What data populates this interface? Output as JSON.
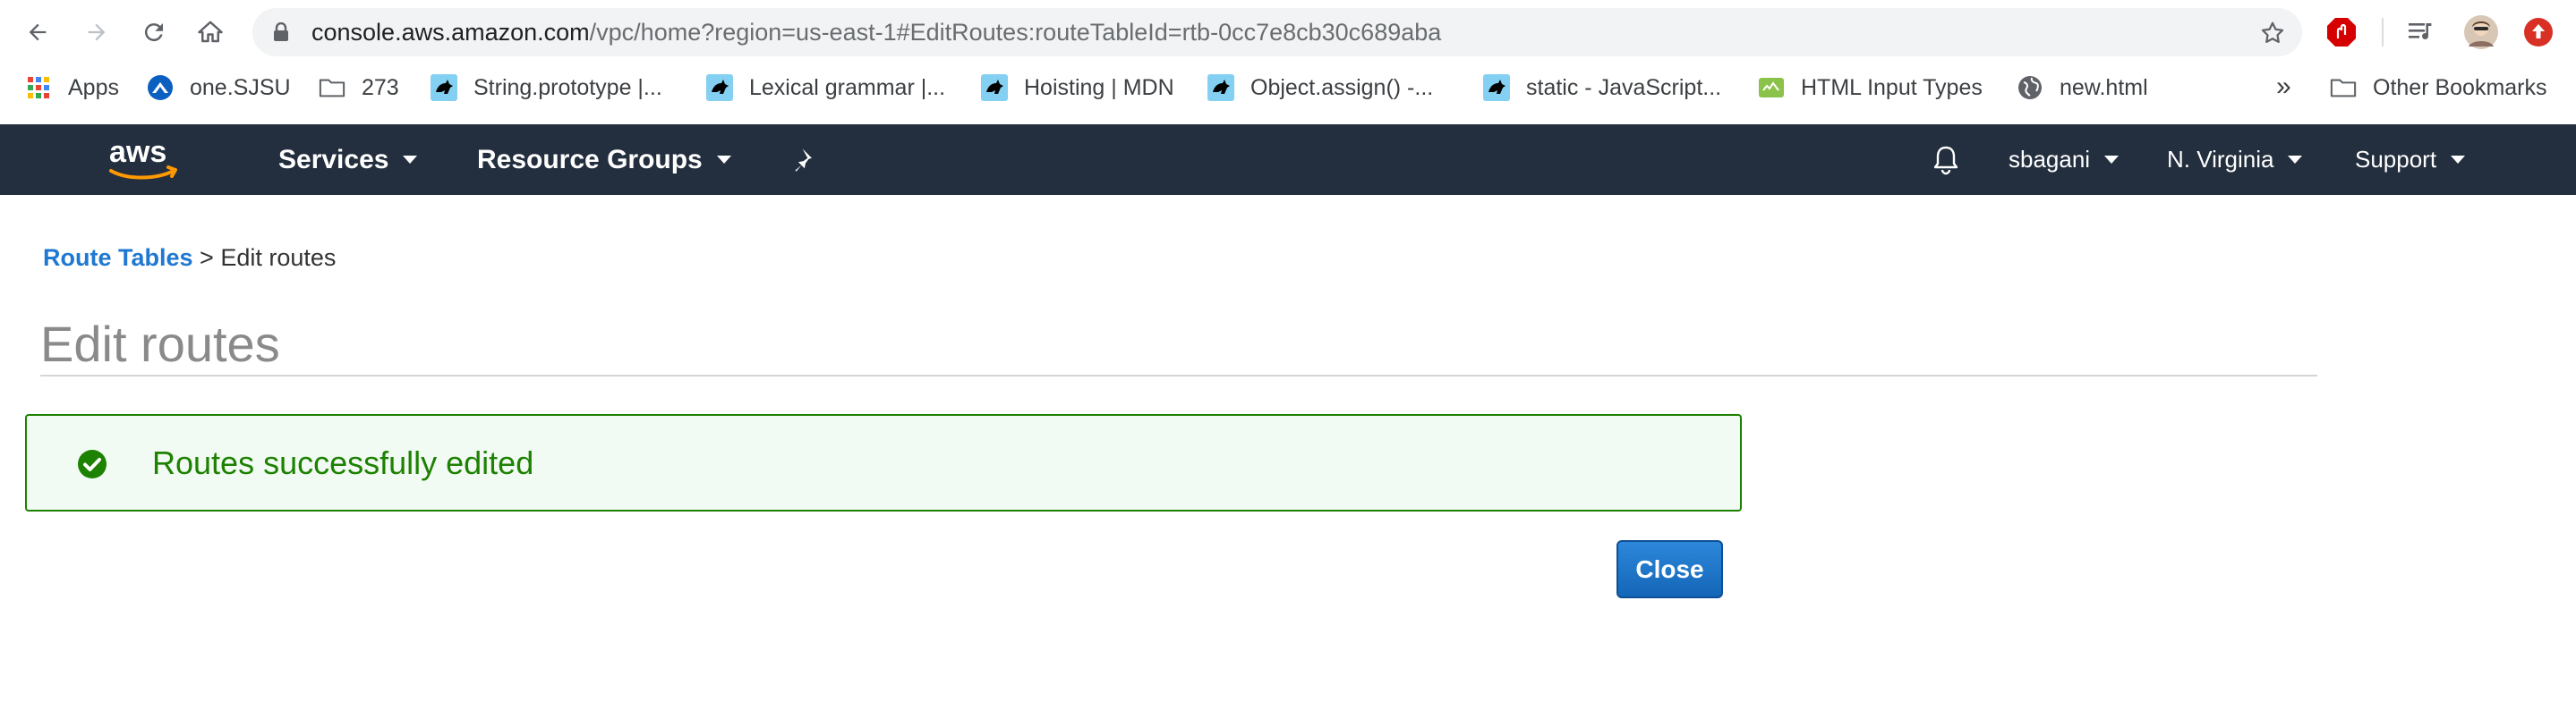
{
  "browser": {
    "url_host": "console.aws.amazon.com",
    "url_path": "/vpc/home?region=us-east-1#EditRoutes:routeTableId=rtb-0cc7e8cb30c689aba"
  },
  "bookmarks": {
    "items": [
      {
        "label": "Apps",
        "icon": "apps-grid-icon"
      },
      {
        "label": "one.SJSU",
        "icon": "sjsu-icon"
      },
      {
        "label": "273",
        "icon": "folder-icon"
      },
      {
        "label": "String.prototype |...",
        "icon": "mdn-icon"
      },
      {
        "label": "Lexical grammar |...",
        "icon": "mdn-icon"
      },
      {
        "label": "Hoisting | MDN",
        "icon": "mdn-icon"
      },
      {
        "label": "Object.assign() -...",
        "icon": "mdn-icon"
      },
      {
        "label": "static - JavaScript...",
        "icon": "mdn-icon"
      },
      {
        "label": "HTML Input Types",
        "icon": "html-input-icon"
      },
      {
        "label": "new.html",
        "icon": "globe-icon"
      }
    ],
    "more": "»",
    "other": "Other Bookmarks"
  },
  "aws_nav": {
    "services": "Services",
    "resource_groups": "Resource Groups",
    "user": "sbagani",
    "region": "N. Virginia",
    "support": "Support"
  },
  "page": {
    "breadcrumb_link": "Route Tables",
    "breadcrumb_sep": ">",
    "breadcrumb_current": "Edit routes",
    "title": "Edit routes",
    "alert_message": "Routes successfully edited",
    "close_label": "Close"
  },
  "colors": {
    "aws_header": "#232f3e",
    "link_blue": "#1f78d1",
    "success_green": "#1d8102",
    "primary_button": "#1f77cf"
  }
}
